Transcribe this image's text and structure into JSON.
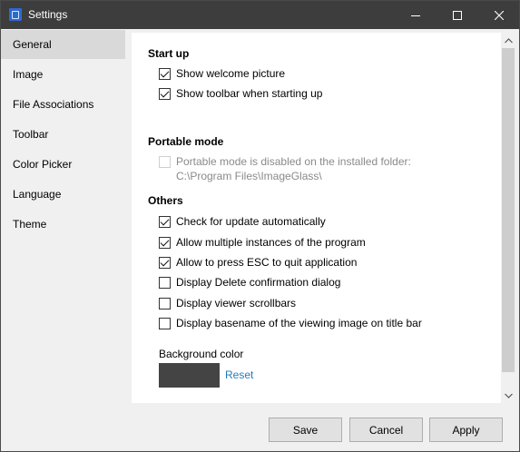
{
  "window": {
    "title": "Settings"
  },
  "sidebar": {
    "items": [
      {
        "label": "General",
        "active": true
      },
      {
        "label": "Image",
        "active": false
      },
      {
        "label": "File Associations",
        "active": false
      },
      {
        "label": "Toolbar",
        "active": false
      },
      {
        "label": "Color Picker",
        "active": false
      },
      {
        "label": "Language",
        "active": false
      },
      {
        "label": "Theme",
        "active": false
      }
    ]
  },
  "general": {
    "startup": {
      "heading": "Start up",
      "options": [
        {
          "label": "Show welcome picture",
          "checked": true
        },
        {
          "label": "Show toolbar when starting up",
          "checked": true
        }
      ]
    },
    "portable": {
      "heading": "Portable mode",
      "option_label": "Portable mode is disabled on the installed folder:",
      "option_checked": false,
      "option_enabled": false,
      "path": "C:\\Program Files\\ImageGlass\\"
    },
    "others": {
      "heading": "Others",
      "options": [
        {
          "label": "Check for update automatically",
          "checked": true
        },
        {
          "label": "Allow multiple instances of the program",
          "checked": true
        },
        {
          "label": "Allow to press ESC to quit application",
          "checked": true
        },
        {
          "label": "Display Delete confirmation dialog",
          "checked": false
        },
        {
          "label": "Display viewer scrollbars",
          "checked": false
        },
        {
          "label": "Display basename of the viewing image on title bar",
          "checked": false
        }
      ]
    },
    "background": {
      "label": "Background color",
      "color": "#444444",
      "reset_label": "Reset"
    }
  },
  "footer": {
    "save_label": "Save",
    "cancel_label": "Cancel",
    "apply_label": "Apply"
  },
  "colors": {
    "titlebar": "#3d3d3d",
    "link": "#1e7dbd",
    "active_nav": "#d9d9d9"
  },
  "icons": [
    "app-icon",
    "minimize-icon",
    "maximize-icon",
    "close-icon",
    "check-icon",
    "scroll-up-icon",
    "scroll-down-icon"
  ]
}
